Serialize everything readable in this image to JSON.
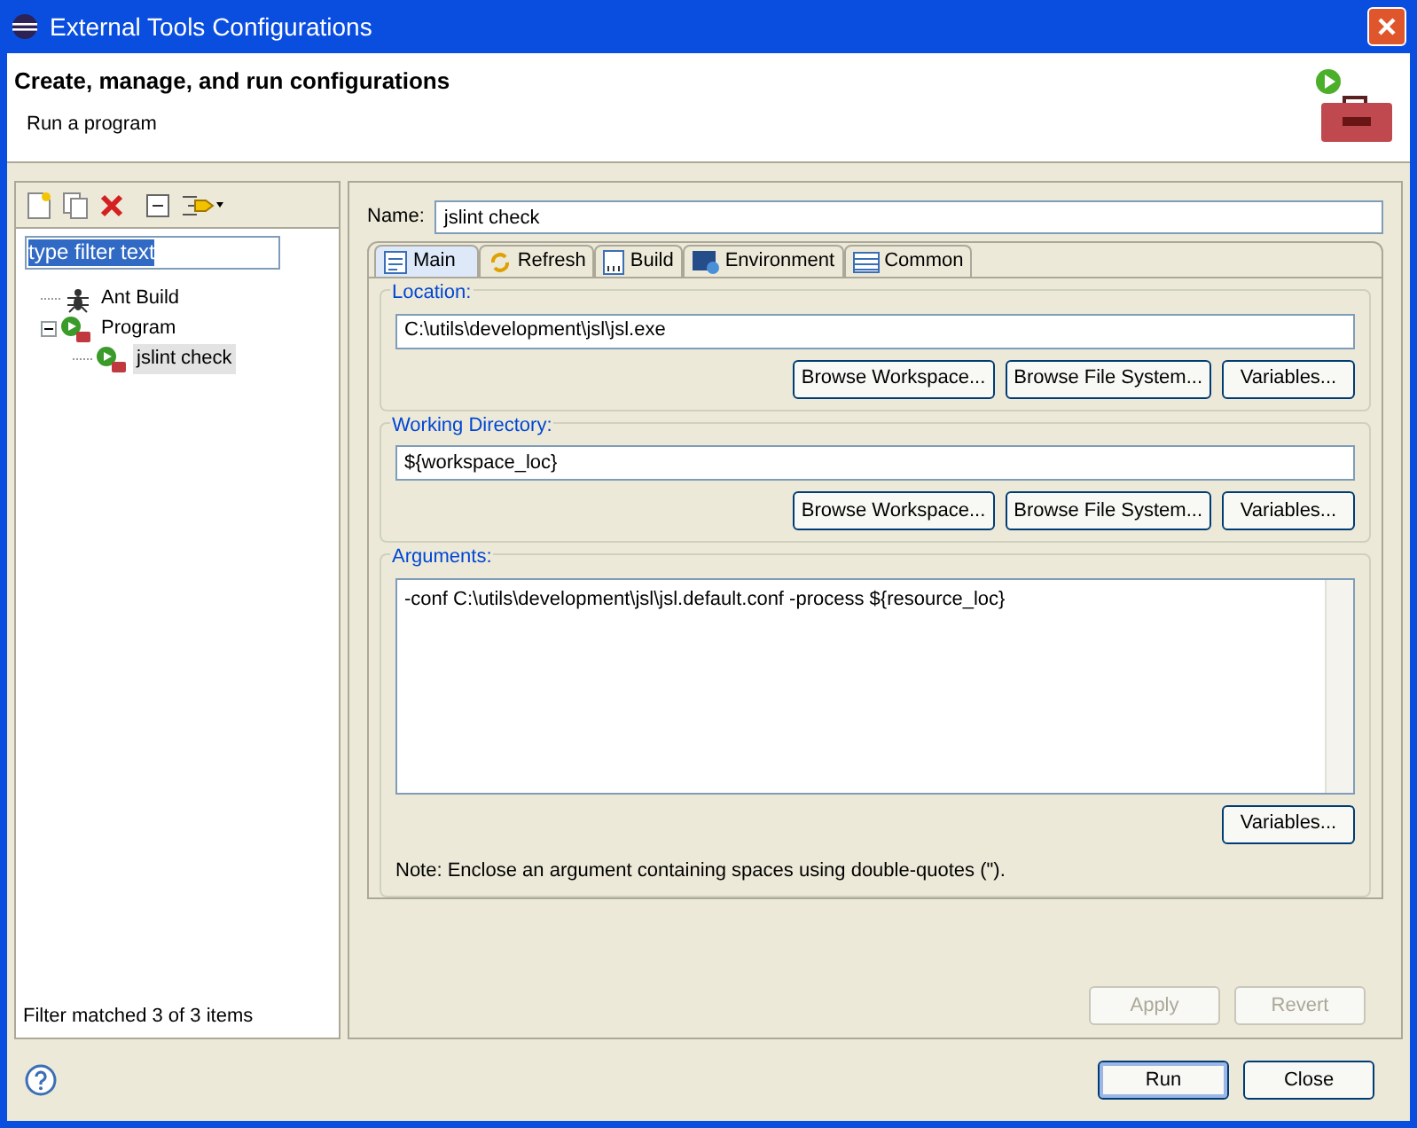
{
  "window": {
    "title": "External Tools Configurations"
  },
  "header": {
    "title": "Create, manage, and run configurations",
    "subtitle": "Run a program"
  },
  "filter": {
    "value": "type filter text"
  },
  "tree": [
    {
      "label": "Ant Build",
      "kind": "ant",
      "selected": false
    },
    {
      "label": "Program",
      "kind": "program",
      "selected": false,
      "expanded": true,
      "children": [
        {
          "label": "jslint check",
          "kind": "program",
          "selected": true
        }
      ]
    }
  ],
  "filter_status": "Filter matched 3 of 3 items",
  "name": {
    "label": "Name:",
    "value": "jslint check"
  },
  "tabs": [
    {
      "label": "Main",
      "kind": "main",
      "selected": true
    },
    {
      "label": "Refresh",
      "kind": "refresh",
      "selected": false
    },
    {
      "label": "Build",
      "kind": "build",
      "selected": false
    },
    {
      "label": "Environment",
      "kind": "environment",
      "selected": false
    },
    {
      "label": "Common",
      "kind": "common",
      "selected": false
    }
  ],
  "groups": [
    {
      "label": "Location:",
      "kind": "field",
      "value": "C:\\utils\\development\\jsl\\jsl.exe",
      "buttons": [
        "Browse Workspace...",
        "Browse File System...",
        "Variables..."
      ]
    },
    {
      "label": "Working Directory:",
      "kind": "field",
      "value": "${workspace_loc}",
      "buttons": [
        "Browse Workspace...",
        "Browse File System...",
        "Variables..."
      ]
    },
    {
      "label": "Arguments:",
      "kind": "textarea",
      "value": "-conf C:\\utils\\development\\jsl\\jsl.default.conf -process ${resource_loc}",
      "buttons": [
        "Variables..."
      ],
      "note": "Note: Enclose an argument containing spaces using double-quotes (\")."
    }
  ],
  "actions": [
    {
      "label": "Apply",
      "disabled": true
    },
    {
      "label": "Revert",
      "disabled": true
    }
  ],
  "dialog_buttons": [
    {
      "label": "Run",
      "selected": true
    },
    {
      "label": "Close",
      "selected": false
    }
  ]
}
